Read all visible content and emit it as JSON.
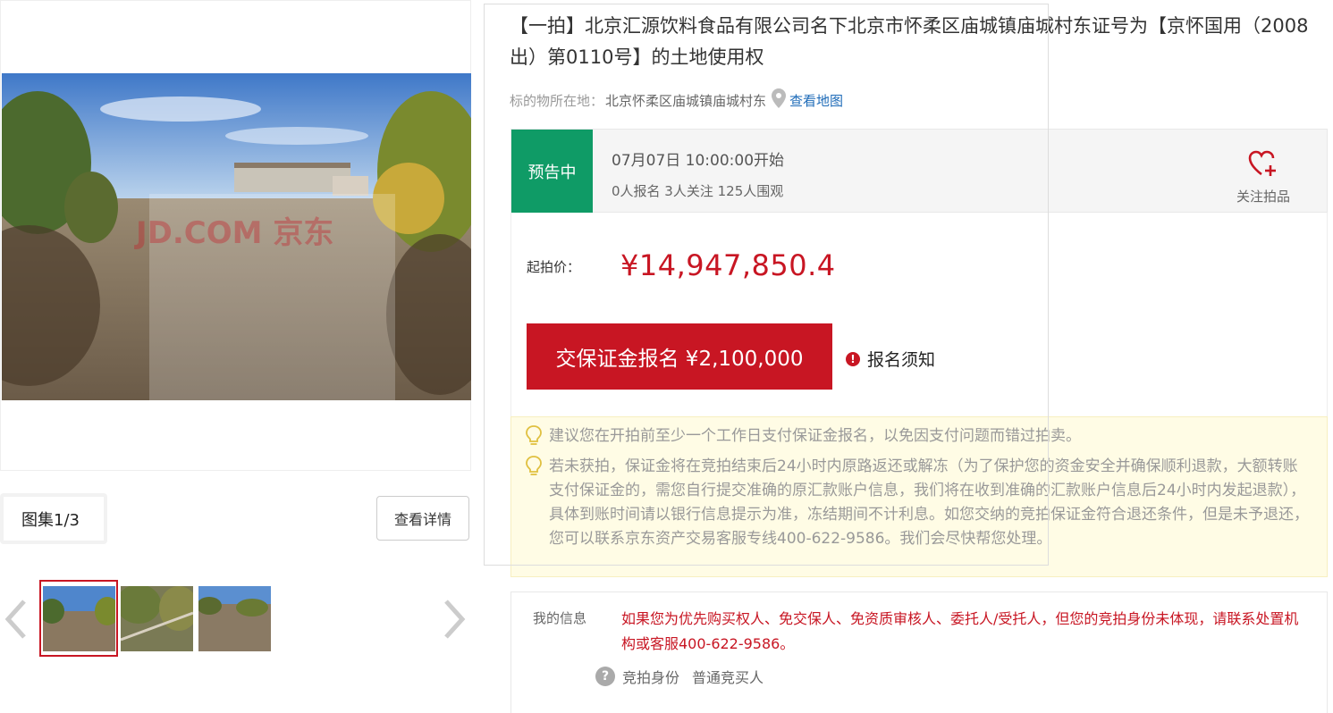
{
  "gallery": {
    "counter": "图集1/3",
    "detail_button": "查看详情",
    "watermark": "JD.COM 京东",
    "thumbnail_count": 3
  },
  "lot": {
    "title": "【一拍】北京汇源饮料食品有限公司名下北京市怀柔区庙城镇庙城村东证号为【京怀国用（2008出）第0110号】的土地使用权",
    "location_label": "标的物所在地：",
    "location_value": "北京怀柔区庙城镇庙城村东",
    "map_link": "查看地图"
  },
  "status": {
    "badge": "预告中",
    "start_time": "07月07日 10:00:00开始",
    "stats": "0人报名  3人关注  125人围观",
    "follow_label": "关注拍品"
  },
  "price": {
    "label": "起拍价：",
    "value": "¥14,947,850.4"
  },
  "actions": {
    "deposit_button": "交保证金报名 ¥2,100,000",
    "notice_link": "报名须知"
  },
  "tips": {
    "tip1": "建议您在开拍前至少一个工作日支付保证金报名，以免因支付问题而错过拍卖。",
    "tip2": "若未获拍，保证金将在竞拍结束后24小时内原路返还或解冻（为了保护您的资金安全并确保顺利退款，大额转账支付保证金的，需您自行提交准确的原汇款账户信息，我们将在收到准确的汇款账户信息后24小时内发起退款），具体到账时间请以银行信息提示为准，冻结期间不计利息。如您交纳的竞拍保证金符合退还条件，但是未予退还，您可以联系京东资产交易客服专线400-622-9586。我们会尽快帮您处理。"
  },
  "my_info": {
    "label": "我的信息",
    "text": "如果您为优先购买权人、免交保人、免资质审核人、委托人/受托人，但您的竞拍身份未体现，请联系处置机构或客服400-622-9586。",
    "identity_label": "竞拍身份",
    "identity_value": "普通竞买人"
  },
  "colors": {
    "accent_red": "#c81623",
    "status_green": "#0f9b66",
    "link_blue": "#1e6bb8",
    "tip_bg": "#fffce5"
  }
}
